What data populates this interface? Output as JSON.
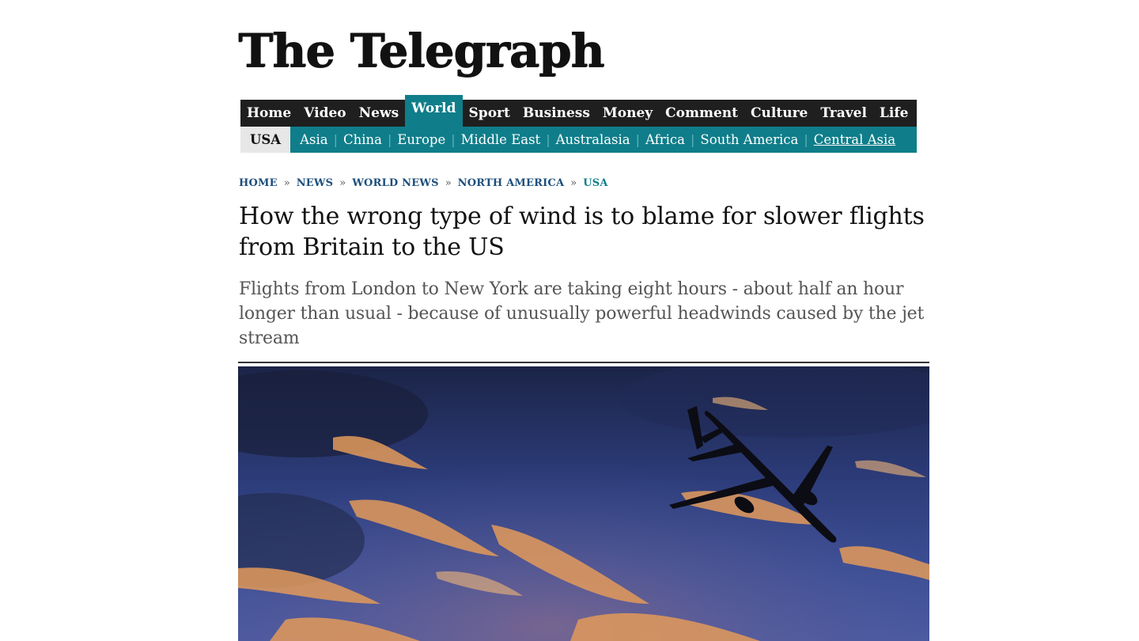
{
  "masthead": {
    "title": "The Telegraph"
  },
  "nav_primary": [
    {
      "label": "Home",
      "active": false
    },
    {
      "label": "Video",
      "active": false
    },
    {
      "label": "News",
      "active": false
    },
    {
      "label": "World",
      "active": true
    },
    {
      "label": "Sport",
      "active": false
    },
    {
      "label": "Business",
      "active": false
    },
    {
      "label": "Money",
      "active": false
    },
    {
      "label": "Comment",
      "active": false
    },
    {
      "label": "Culture",
      "active": false
    },
    {
      "label": "Travel",
      "active": false
    },
    {
      "label": "Life",
      "active": false
    }
  ],
  "nav_secondary": [
    {
      "label": "USA"
    },
    {
      "label": "Asia"
    },
    {
      "label": "China"
    },
    {
      "label": "Europe"
    },
    {
      "label": "Middle East"
    },
    {
      "label": "Australasia"
    },
    {
      "label": "Africa"
    },
    {
      "label": "South America"
    },
    {
      "label": "Central Asia"
    }
  ],
  "breadcrumb": [
    "HOME",
    "NEWS",
    "WORLD NEWS",
    "NORTH AMERICA",
    "USA"
  ],
  "breadcrumb_separator": "»",
  "article": {
    "headline": "How the wrong type of wind is to blame for slower flights from Britain to the US",
    "standfirst": "Flights from London to New York are taking eight hours - about half an hour longer than usual - because of unusually powerful headwinds caused by the jet stream"
  },
  "hero_image": {
    "subject": "airplane silhouette against sunset sky"
  },
  "colors": {
    "nav_dark": "#1f1f1f",
    "accent_teal": "#0f7e8a",
    "breadcrumb_blue": "#1d4f7c"
  }
}
